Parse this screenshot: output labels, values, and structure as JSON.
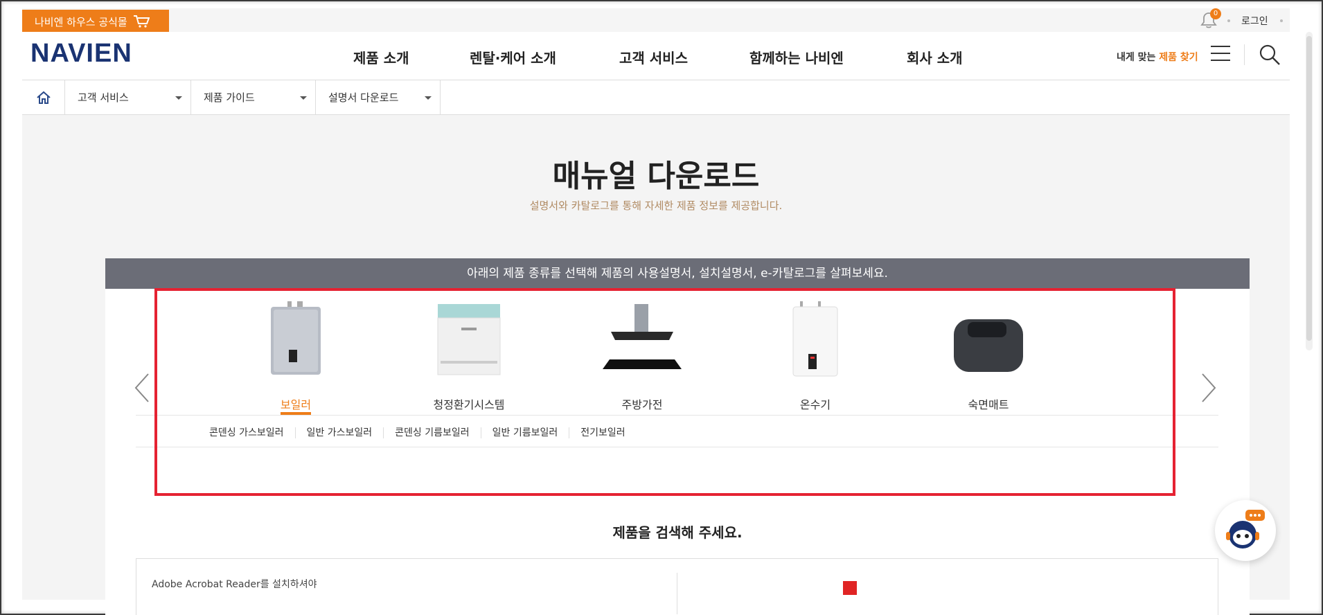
{
  "topbar": {
    "shop_label": "나비엔 하우스 공식몰",
    "notification_count": "0",
    "login_label": "로그인"
  },
  "header": {
    "logo": "NAVIEN",
    "nav": [
      "제품 소개",
      "렌탈·케어 소개",
      "고객 서비스",
      "함께하는 나비엔",
      "회사 소개"
    ],
    "finder_prefix": "내게 맞는",
    "finder_highlight": "제품 찾기"
  },
  "breadcrumb": {
    "items": [
      "고객 서비스",
      "제품 가이드",
      "설명서 다운로드"
    ]
  },
  "page": {
    "title": "매뉴얼 다운로드",
    "subtitle": "설명서와 카탈로그를 통해 자세한 제품 정보를 제공합니다.",
    "guide": "아래의 제품 종류를 선택해 제품의 사용설명서, 설치설명서, e-카탈로그를 살펴보세요.",
    "search_title": "제품을 검색해 주세요.",
    "acrobat_note": "Adobe Acrobat Reader를 설치하셔야"
  },
  "categories": [
    {
      "label": "보일러",
      "icon": "boiler-icon",
      "active": true
    },
    {
      "label": "청정환기시스템",
      "icon": "ventilation-icon",
      "active": false
    },
    {
      "label": "주방가전",
      "icon": "kitchen-hood-icon",
      "active": false
    },
    {
      "label": "온수기",
      "icon": "water-heater-icon",
      "active": false
    },
    {
      "label": "숙면매트",
      "icon": "sleep-mat-icon",
      "active": false
    }
  ],
  "subcategories": [
    "콘덴싱 가스보일러",
    "일반 가스보일러",
    "콘덴싱 기름보일러",
    "일반 기름보일러",
    "전기보일러"
  ],
  "colors": {
    "accent": "#ee7d19",
    "brand": "#1a3372",
    "guide_bar": "#6b6d77",
    "highlight": "#e52232"
  }
}
